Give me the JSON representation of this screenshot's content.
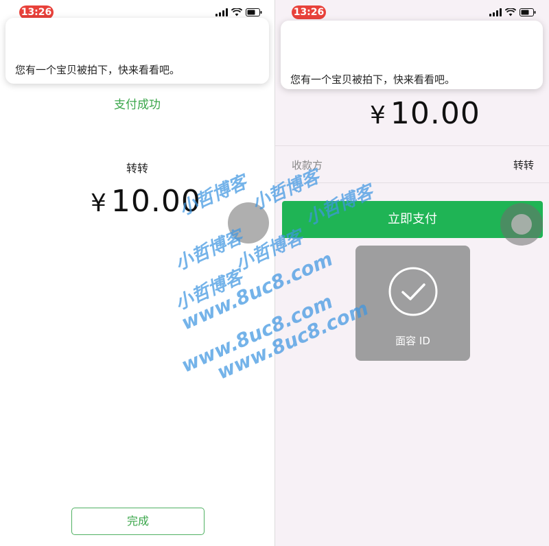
{
  "status_bar": {
    "time": "13:26"
  },
  "notification": {
    "message": "您有一个宝贝被拍下，快来看看吧。"
  },
  "left_screen": {
    "status_text": "支付成功",
    "payee": "转转",
    "amount": {
      "currency": "¥",
      "value": "10.00"
    },
    "done_button": "完成"
  },
  "right_screen": {
    "amount": {
      "currency": "¥",
      "value": "10.00"
    },
    "payee_row": {
      "label": "收款方",
      "value": "转转"
    },
    "pay_button": "立即支付",
    "face_id": {
      "label": "面容 ID"
    }
  },
  "watermarks": [
    "小哲博客",
    "小哲博客",
    "小哲博客",
    "小哲博客",
    "小哲博客",
    "小哲博客",
    "www.8uc8.com",
    "www.8uc8.com",
    "www.8uc8.com"
  ],
  "colors": {
    "accent_green": "#1fb455",
    "text_green": "#3aa64a",
    "time_pill": "#e8413a",
    "watermark": "#3e96e1"
  }
}
